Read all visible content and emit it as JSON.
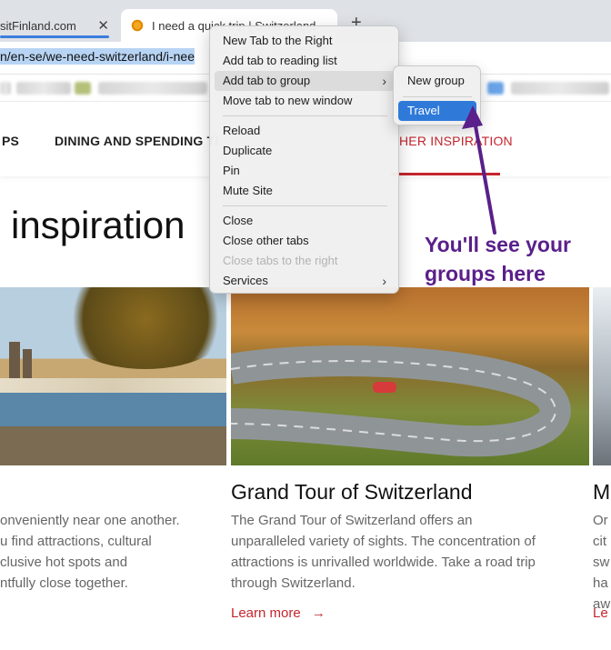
{
  "tabs": [
    {
      "title": "sitFinland.com",
      "close": "✕"
    },
    {
      "title": "I need a quick trip | Switzerland",
      "close": "✕"
    }
  ],
  "new_tab_glyph": "+",
  "address_bar": {
    "url_prefix": "n/en-se/we-need-switzerland/i-nee"
  },
  "site_nav": {
    "items": [
      "PS",
      "DINING AND SPENDING TI",
      "HER INSPIRATION"
    ],
    "active_index": 2,
    "accent_color": "#c4262e"
  },
  "page_heading": "inspiration",
  "cards": [
    {
      "title": "",
      "text_lines": [
        "onveniently near one another.",
        "u find attractions, cultural",
        "clusive hot spots and",
        "ntfully close together."
      ],
      "link": ""
    },
    {
      "title": "Grand Tour of Switzerland",
      "text_lines": [
        "The Grand Tour of Switzerland offers an",
        "unparalleled variety of sights. The concentration of",
        "attractions is unrivalled worldwide. Take a road trip",
        "through Switzerland."
      ],
      "link": "Learn more",
      "link_arrow": "→"
    },
    {
      "title": "M",
      "text_lines": [
        "Or",
        "cit",
        "sw",
        "ha",
        "aw"
      ],
      "link": "Le"
    }
  ],
  "context_menu": {
    "items": [
      {
        "label": "New Tab to the Right"
      },
      {
        "label": "Add tab to reading list"
      },
      {
        "label": "Add tab to group",
        "submenu": true,
        "highlighted": true
      },
      {
        "label": "Move tab to new window"
      },
      {
        "label": "Reload"
      },
      {
        "label": "Duplicate"
      },
      {
        "label": "Pin"
      },
      {
        "label": "Mute Site"
      },
      {
        "label": "Close"
      },
      {
        "label": "Close other tabs"
      },
      {
        "label": "Close tabs to the right",
        "disabled": true
      },
      {
        "label": "Services",
        "submenu": true
      }
    ],
    "chevron": "›"
  },
  "group_submenu": {
    "items": [
      {
        "label": "New group"
      },
      {
        "label": "Travel",
        "selected": true
      }
    ],
    "selected_color": "#2f7ad9"
  },
  "annotation": {
    "lines": [
      "You'll see your",
      "groups here"
    ],
    "color": "#5a1f8a"
  }
}
